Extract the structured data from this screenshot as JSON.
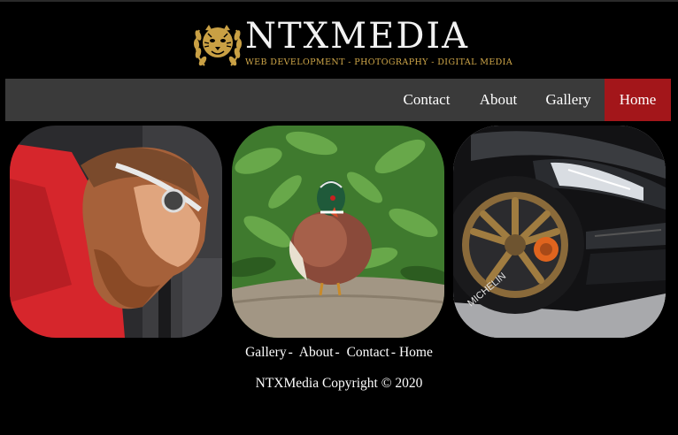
{
  "brand": {
    "name": "NTXMedia",
    "wordmark": "NTXMEDIA",
    "tagline": "WEB DEVELOPMENT - PHOTOGRAPHY - DIGITAL MEDIA",
    "gold": "#d1a84a",
    "emblem_icon": "tiger-laurel-icon"
  },
  "nav": {
    "items": [
      {
        "label": "Contact"
      },
      {
        "label": "About"
      },
      {
        "label": "Gallery"
      },
      {
        "label": "Home",
        "active": true
      }
    ],
    "bar_color": "#3a3a3a",
    "active_color": "#a3161a"
  },
  "gallery": {
    "photos": [
      {
        "subject": "man-portrait-photo"
      },
      {
        "subject": "wood-duck-photo"
      },
      {
        "subject": "sports-car-wheel-photo"
      }
    ]
  },
  "footer": {
    "links": [
      "Gallery",
      "About",
      "Contact",
      "Home"
    ],
    "separator": "-",
    "copyright": "NTXMedia Copyright © 2020"
  }
}
